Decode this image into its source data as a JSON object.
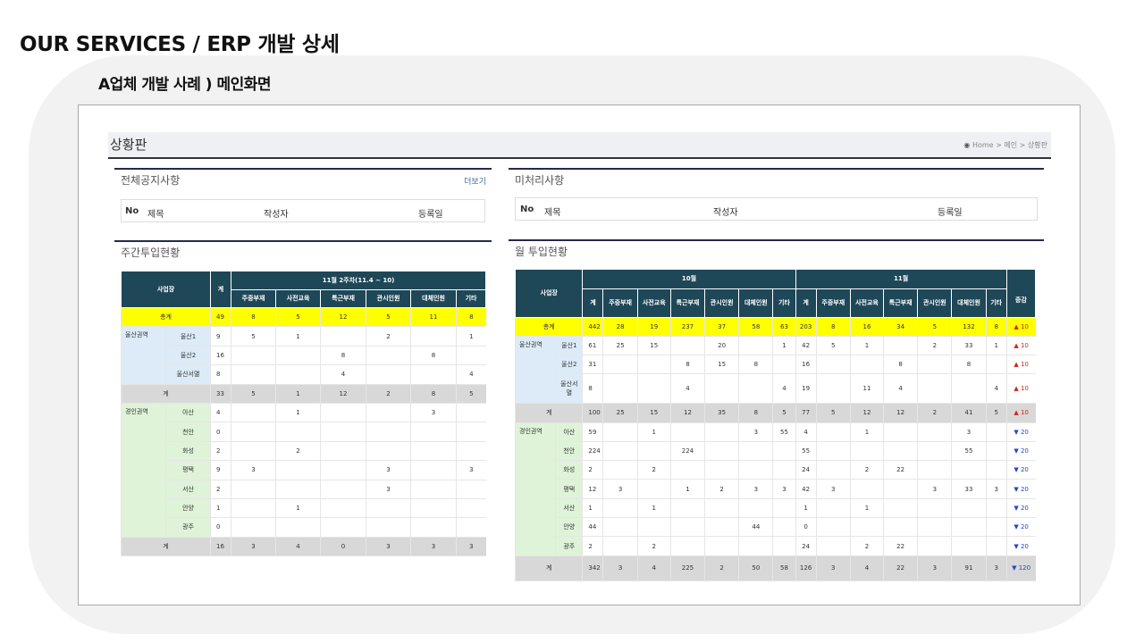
{
  "page_title": "OUR SERVICES / ERP 개발 상세",
  "subtitle": "A업체 개발 사례 ) 메인화면",
  "app": {
    "title": "상황판",
    "breadcrumb": {
      "home": "Home",
      "sep": ">",
      "main": "메인",
      "current": "상황판"
    }
  },
  "notice": {
    "title": "전체공지사항",
    "more": "더보기",
    "columns": {
      "no": "No",
      "title": "제목",
      "author": "작성자",
      "date": "등록일"
    }
  },
  "pending": {
    "title": "미처리사항",
    "columns": {
      "no": "No",
      "title": "제목",
      "author": "작성자",
      "date": "등록일"
    }
  },
  "weekly": {
    "title": "주간투입현황",
    "headers": {
      "site": "사업장",
      "sum": "계",
      "period": "11월 2주차(11.4 ~ 10)"
    },
    "cols": [
      "주중부재",
      "사전교육",
      "특근부재",
      "관시인원",
      "대체인원",
      "기타"
    ],
    "total": {
      "label": "총계",
      "values": [
        "49",
        "8",
        "5",
        "12",
        "5",
        "11",
        "8"
      ]
    },
    "groups": [
      {
        "name": "울산권역",
        "rows": [
          {
            "site": "울산1",
            "values": [
              "9",
              "5",
              "1",
              "",
              "2",
              "",
              "1"
            ]
          },
          {
            "site": "울산2",
            "values": [
              "16",
              "",
              "",
              "8",
              "",
              "8",
              ""
            ]
          },
          {
            "site": "울산서멸",
            "values": [
              "8",
              "",
              "",
              "4",
              "",
              "",
              "4"
            ]
          }
        ],
        "subtotal": {
          "label": "계",
          "values": [
            "33",
            "5",
            "1",
            "12",
            "2",
            "8",
            "5"
          ]
        }
      },
      {
        "name": "경인권역",
        "rows": [
          {
            "site": "아산",
            "values": [
              "4",
              "",
              "1",
              "",
              "",
              "3",
              ""
            ]
          },
          {
            "site": "천안",
            "values": [
              "0",
              "",
              "",
              "",
              "",
              "",
              ""
            ]
          },
          {
            "site": "화성",
            "values": [
              "2",
              "",
              "2",
              "",
              "",
              "",
              ""
            ]
          },
          {
            "site": "평택",
            "values": [
              "9",
              "3",
              "",
              "",
              "3",
              "",
              "3"
            ]
          },
          {
            "site": "서산",
            "values": [
              "2",
              "",
              "",
              "",
              "3",
              "",
              ""
            ]
          },
          {
            "site": "안양",
            "values": [
              "1",
              "",
              "1",
              "",
              "",
              "",
              ""
            ]
          },
          {
            "site": "광주",
            "values": [
              "0",
              "",
              "",
              "",
              "",
              "",
              ""
            ]
          }
        ],
        "subtotal": {
          "label": "계",
          "values": [
            "16",
            "3",
            "4",
            "0",
            "3",
            "3",
            "3"
          ]
        }
      }
    ]
  },
  "monthly": {
    "title": "월 투입현황",
    "headers": {
      "site": "사업장",
      "month1": "10월",
      "month2": "11월",
      "change": "증감",
      "sum": "계"
    },
    "cols": [
      "주중부재",
      "사전교육",
      "특근부재",
      "관시인원",
      "대체인원",
      "기타"
    ],
    "total": {
      "label": "총계",
      "values": [
        "442",
        "28",
        "19",
        "237",
        "37",
        "58",
        "63",
        "203",
        "8",
        "16",
        "34",
        "5",
        "132",
        "8"
      ],
      "change": "▲ 10"
    },
    "groups": [
      {
        "name": "울산권역",
        "rows": [
          {
            "site": "울산1",
            "values": [
              "61",
              "25",
              "15",
              "",
              "20",
              "",
              "1",
              "42",
              "5",
              "1",
              "",
              "2",
              "33",
              "1"
            ],
            "change": "▲ 10"
          },
          {
            "site": "울산2",
            "values": [
              "31",
              "",
              "",
              "8",
              "15",
              "8",
              "",
              "16",
              "",
              "",
              "8",
              "",
              "8",
              ""
            ],
            "change": "▲ 10"
          },
          {
            "site": "울산서멸",
            "values": [
              "8",
              "",
              "",
              "4",
              "",
              "",
              "4",
              "19",
              "",
              "11",
              "4",
              "",
              "",
              "4"
            ],
            "change": "▲ 10"
          }
        ],
        "subtotal": {
          "label": "계",
          "values": [
            "100",
            "25",
            "15",
            "12",
            "35",
            "8",
            "5",
            "77",
            "5",
            "12",
            "12",
            "2",
            "41",
            "5"
          ],
          "change": "▲ 10"
        }
      },
      {
        "name": "경인권역",
        "rows": [
          {
            "site": "아산",
            "values": [
              "59",
              "",
              "1",
              "",
              "",
              "3",
              "55",
              "4",
              "",
              "1",
              "",
              "",
              "3",
              ""
            ],
            "change": "▼ 20"
          },
          {
            "site": "천안",
            "values": [
              "224",
              "",
              "",
              "224",
              "",
              "",
              "",
              "55",
              "",
              "",
              "",
              "",
              "55",
              ""
            ],
            "change": "▼ 20"
          },
          {
            "site": "화성",
            "values": [
              "2",
              "",
              "2",
              "",
              "",
              "",
              "",
              "24",
              "",
              "2",
              "22",
              "",
              "",
              ""
            ],
            "change": "▼ 20"
          },
          {
            "site": "평택",
            "values": [
              "12",
              "3",
              "",
              "1",
              "2",
              "3",
              "3",
              "42",
              "3",
              "",
              "",
              "3",
              "33",
              "3"
            ],
            "change": "▼ 20"
          },
          {
            "site": "서산",
            "values": [
              "1",
              "",
              "1",
              "",
              "",
              "",
              "",
              "1",
              "",
              "1",
              "",
              "",
              "",
              ""
            ],
            "change": "▼ 20"
          },
          {
            "site": "안양",
            "values": [
              "44",
              "",
              "",
              "",
              "",
              "44",
              "",
              "0",
              "",
              "",
              "",
              "",
              "",
              ""
            ],
            "change": "▼ 20"
          },
          {
            "site": "광주",
            "values": [
              "2",
              "",
              "2",
              "",
              "",
              "",
              "",
              "24",
              "",
              "2",
              "22",
              "",
              "",
              ""
            ],
            "change": "▼ 20"
          }
        ],
        "subtotal": {
          "label": "계",
          "values": [
            "342",
            "3",
            "4",
            "225",
            "2",
            "50",
            "58",
            "126",
            "3",
            "4",
            "22",
            "3",
            "91",
            "3"
          ],
          "change": "▼ 120"
        }
      }
    ]
  }
}
